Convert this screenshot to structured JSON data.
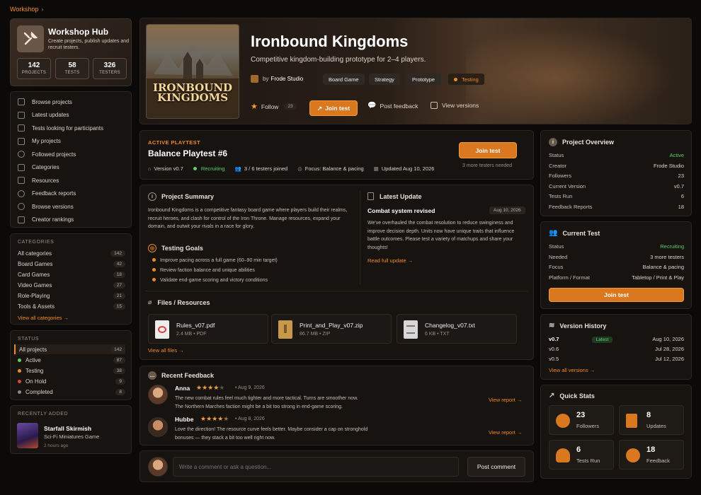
{
  "breadcrumb": {
    "label": "Workshop",
    "sep": "›"
  },
  "hub": {
    "title": "Workshop Hub",
    "desc": "Create projects, publish updates and recruit testers.",
    "stats": [
      {
        "value": "142",
        "label": "PROJECTS"
      },
      {
        "value": "58",
        "label": "TESTS"
      },
      {
        "value": "326",
        "label": "TESTERS"
      }
    ]
  },
  "nav": [
    "Browse projects",
    "Latest updates",
    "Tests looking for participants",
    "My projects",
    "Followed projects",
    "Categories",
    "Resources",
    "Feedback reports",
    "Browse versions",
    "Creator rankings"
  ],
  "categories": {
    "title": "CATEGORIES",
    "items": [
      {
        "label": "All categories",
        "count": "142"
      },
      {
        "label": "Board Games",
        "count": "42"
      },
      {
        "label": "Card Games",
        "count": "18"
      },
      {
        "label": "Video Games",
        "count": "27"
      },
      {
        "label": "Role-Playing",
        "count": "21"
      },
      {
        "label": "Tools & Assets",
        "count": "15"
      }
    ],
    "view_all": "View all categories →"
  },
  "status": {
    "title": "STATUS",
    "items": [
      {
        "label": "All projects",
        "count": "142",
        "color": "#f08a24"
      },
      {
        "label": "Active",
        "count": "87",
        "color": "#5fcf6a"
      },
      {
        "label": "Testing",
        "count": "38",
        "color": "#f08a24"
      },
      {
        "label": "On Hold",
        "count": "9",
        "color": "#e0483a"
      },
      {
        "label": "Completed",
        "count": "8",
        "color": "#8a8a8a"
      }
    ]
  },
  "recent": {
    "title": "RECENTLY ADDED",
    "name": "Starfall Skirmish",
    "type": "Sci-Fi Miniatures Game",
    "time": "2 hours ago"
  },
  "project": {
    "cover_title": "IRONBOUND KINGDOMS",
    "title": "Ironbound Kingdoms",
    "subtitle": "Competitive kingdom-building prototype for 2–4 players.",
    "by": "by",
    "studio": "Frode Studio",
    "tags": [
      "Board Game",
      "Strategy",
      "Prototype"
    ],
    "status_tag": "Testing",
    "follow": "Follow",
    "follow_count": "23",
    "join": "Join test",
    "post_feedback": "Post feedback",
    "view_versions": "View versions"
  },
  "playtest": {
    "eyebrow": "ACTIVE PLAYTEST",
    "title": "Balance Playtest #6",
    "version": "Version v0.7",
    "status": "Recruiting",
    "joined": "3 / 6 testers joined",
    "focus": "Focus: Balance & pacing",
    "updated": "Updated Aug 10, 2026",
    "join": "Join test",
    "needed": "3 more testers needed"
  },
  "summary": {
    "title": "Project Summary",
    "text": "Ironbound Kingdoms is a competitive fantasy board game where players build their realms, recruit heroes, and clash for control of the Iron Throne. Manage resources, expand your domain, and outwit your rivals in a race for glory.",
    "goals_title": "Testing Goals",
    "goals": [
      "Improve pacing across a full game (60–90 min target)",
      "Review faction balance and unique abilities",
      "Validate end-game scoring and victory conditions"
    ],
    "update_title": "Latest Update",
    "update_headline": "Combat system revised",
    "update_date": "Aug 10, 2026",
    "update_text": "We've overhauled the combat resolution to reduce swinginess and improve decision depth. Units now have unique traits that influence battle outcomes. Please test a variety of matchups and share your thoughts!",
    "read_more": "Read full update →",
    "files_title": "Files / Resources",
    "files": [
      {
        "name": "Rules_v07.pdf",
        "meta": "2.4 MB • PDF",
        "color": "#d9403a"
      },
      {
        "name": "Print_and_Play_v07.zip",
        "meta": "86.7 MB • ZIP",
        "color": "#c9994a"
      },
      {
        "name": "Changelog_v07.txt",
        "meta": "6 KB • TXT",
        "color": "#d8d8d8"
      }
    ],
    "view_files": "View all files →"
  },
  "feedback": {
    "title": "Recent Feedback",
    "items": [
      {
        "name": "Anna",
        "stars": 4,
        "date": "Aug 9, 2026",
        "text1": "The new combat rules feel much tighter and more tactical. Turns are smoother now.",
        "text2": "The Northern Marches faction might be a bit too strong in end-game scoring.",
        "link": "View report →"
      },
      {
        "name": "Hubbe",
        "stars": 4.5,
        "date": "Aug 8, 2026",
        "text1": "Love the direction! The resource curve feels better. Maybe consider a cap on stronghold",
        "text2": "bonuses — they stack a bit too well right now.",
        "link": "View report →"
      }
    ]
  },
  "comment": {
    "placeholder": "Write a comment or ask a question...",
    "button": "Post comment"
  },
  "overview": {
    "title": "Project Overview",
    "rows": [
      {
        "k": "Status",
        "v": "Active"
      },
      {
        "k": "Creator",
        "v": "Frode Studio"
      },
      {
        "k": "Followers",
        "v": "23"
      },
      {
        "k": "Current Version",
        "v": "v0.7"
      },
      {
        "k": "Tests Run",
        "v": "6"
      },
      {
        "k": "Feedback Reports",
        "v": "18"
      }
    ]
  },
  "current": {
    "title": "Current Test",
    "rows": [
      {
        "k": "Status",
        "v": "Recruiting"
      },
      {
        "k": "Needed",
        "v": "3 more testers"
      },
      {
        "k": "Focus",
        "v": "Balance & pacing"
      },
      {
        "k": "Platform / Format",
        "v": "Tabletop / Print & Play"
      }
    ],
    "join": "Join test"
  },
  "versions": {
    "title": "Version History",
    "rows": [
      {
        "k": "v0.7",
        "badge": "Latest",
        "v": "Aug 10, 2026"
      },
      {
        "k": "v0.6",
        "v": "Jul 28, 2026"
      },
      {
        "k": "v0.5",
        "v": "Jul 12, 2026"
      }
    ],
    "view_all": "View all versions →"
  },
  "quick": {
    "title": "Quick Stats",
    "items": [
      {
        "value": "23",
        "label": "Followers"
      },
      {
        "value": "8",
        "label": "Updates"
      },
      {
        "value": "6",
        "label": "Tests Run"
      },
      {
        "value": "18",
        "label": "Feedback"
      }
    ]
  }
}
